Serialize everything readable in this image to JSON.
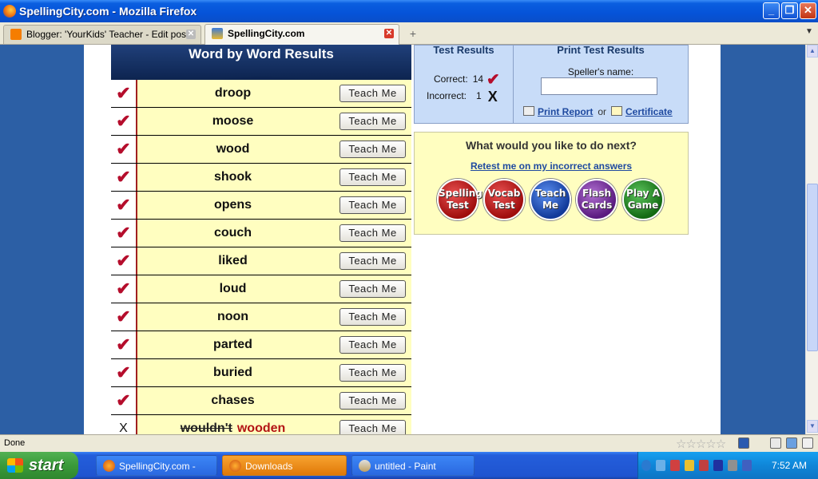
{
  "window": {
    "title": "SpellingCity.com - Mozilla Firefox"
  },
  "tabs": [
    {
      "label": "Blogger: 'YourKids' Teacher - Edit post",
      "active": false
    },
    {
      "label": "SpellingCity.com",
      "active": true
    }
  ],
  "results": {
    "header": "Word by Word Results",
    "teach_label": "Teach Me",
    "words": [
      {
        "mark": "✔",
        "word": "droop"
      },
      {
        "mark": "✔",
        "word": "moose"
      },
      {
        "mark": "✔",
        "word": "wood"
      },
      {
        "mark": "✔",
        "word": "shook"
      },
      {
        "mark": "✔",
        "word": "opens"
      },
      {
        "mark": "✔",
        "word": "couch"
      },
      {
        "mark": "✔",
        "word": "liked"
      },
      {
        "mark": "✔",
        "word": "loud"
      },
      {
        "mark": "✔",
        "word": "noon"
      },
      {
        "mark": "✔",
        "word": "parted"
      },
      {
        "mark": "✔",
        "word": "buried"
      },
      {
        "mark": "✔",
        "word": "chases"
      },
      {
        "mark": "X",
        "word": "wouldn't",
        "correction": "wooden"
      }
    ]
  },
  "test_results": {
    "title": "Test Results",
    "correct_label": "Correct:",
    "correct_count": "14",
    "correct_mark": "✔",
    "incorrect_label": "Incorrect:",
    "incorrect_count": "1",
    "incorrect_mark": "X"
  },
  "print_results": {
    "title": "Print Test Results",
    "speller_label": "Speller's name:",
    "speller_value": "",
    "report_link": "Print Report",
    "or_text": "or",
    "certificate_link": "Certificate"
  },
  "next": {
    "question": "What would you like to do next?",
    "retest_link": "Retest me on my incorrect answers",
    "buttons": [
      {
        "line1": "Spelling",
        "line2": "Test",
        "color": "#b01818"
      },
      {
        "line1": "Vocab",
        "line2": "Test",
        "color": "#b01818"
      },
      {
        "line1": "Teach",
        "line2": "Me",
        "color": "#1a4ab0"
      },
      {
        "line1": "Flash",
        "line2": "Cards",
        "color": "#6a2a90"
      },
      {
        "line1": "Play A",
        "line2": "Game",
        "color": "#1a7a1a"
      }
    ]
  },
  "status": {
    "text": "Done"
  },
  "taskbar": {
    "start_label": "start",
    "tasks": [
      {
        "label": "SpellingCity.com - Mo..."
      },
      {
        "label": "Downloads"
      },
      {
        "label": "untitled - Paint"
      }
    ],
    "clock": "7:52 AM"
  }
}
